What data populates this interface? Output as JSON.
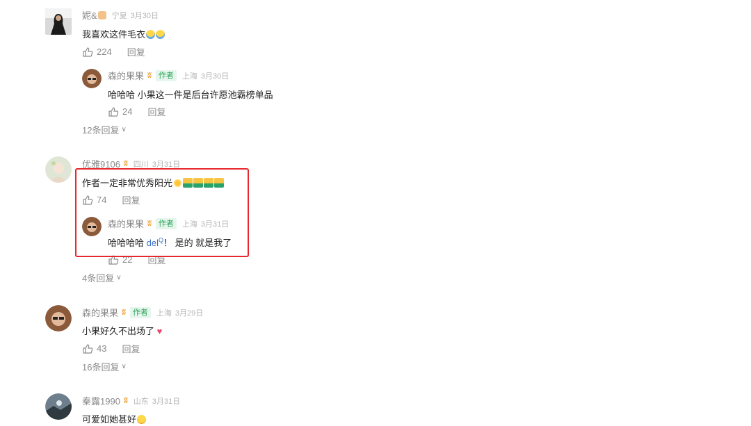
{
  "comments": [
    {
      "user": "妮&",
      "location": "宁夏",
      "date": "3月30日",
      "text": "我喜欢这件毛衣",
      "likes": "224",
      "reply_label": "回复",
      "reply": {
        "user": "森的果果",
        "badge": "作者",
        "location": "上海",
        "date": "3月30日",
        "text": "哈哈哈 小果这一件是后台许愿池霸榜单品",
        "likes": "24",
        "reply_label": "回复"
      },
      "more_replies": "12条回复"
    },
    {
      "user": "优雅9106",
      "location": "四川",
      "date": "3月31日",
      "text": "作者一定非常优秀阳光",
      "likes": "74",
      "reply_label": "回复",
      "reply": {
        "user": "森的果果",
        "badge": "作者",
        "location": "上海",
        "date": "3月31日",
        "text_before": "哈哈哈哈 ",
        "link_word": "del",
        "text_after": "！ 是的 就是我了",
        "likes": "22",
        "reply_label": "回复"
      },
      "more_replies": "4条回复"
    },
    {
      "user": "森的果果",
      "badge": "作者",
      "location": "上海",
      "date": "3月29日",
      "text": "小果好久不出场了",
      "likes": "43",
      "reply_label": "回复",
      "more_replies": "16条回复"
    },
    {
      "user": "秦露1990",
      "location": "山东",
      "date": "3月31日",
      "text": "可爱如她甚好"
    }
  ],
  "colors": {
    "highlight": "#e8262b",
    "author_badge_bg": "#e6f6ec",
    "author_badge_text": "#2ba45a",
    "crown": "#f0a030"
  }
}
